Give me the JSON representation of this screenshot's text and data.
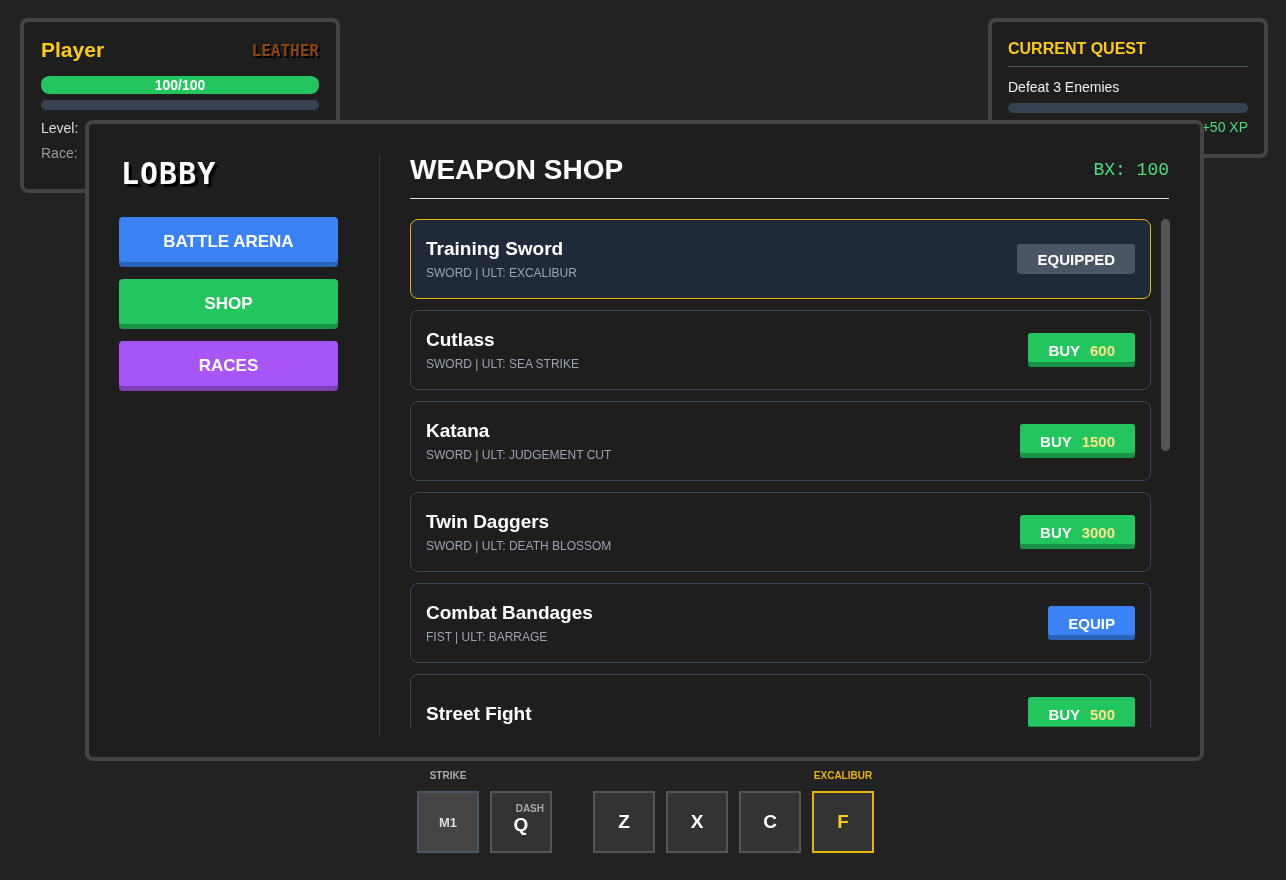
{
  "player": {
    "name": "Player",
    "tier": "LEATHER",
    "hp_text": "100/100",
    "hp": {
      "level": 1
    },
    "xp": {
      "level": 0
    },
    "level_label": "Level:",
    "race_label": "Race:"
  },
  "quest": {
    "title": "CURRENT QUEST",
    "task": "Defeat 3 Enemies",
    "progress": {
      "level": 0
    },
    "reward": "+50 XP"
  },
  "lobby": {
    "title": "LOBBY",
    "nav": [
      {
        "label": "BATTLE ARENA",
        "color": "#3b82f6"
      },
      {
        "label": "SHOP",
        "color": "#22c55e"
      },
      {
        "label": "RACES",
        "color": "#a855f7"
      }
    ]
  },
  "shop": {
    "title": "WEAPON SHOP",
    "balance": "BX: 100",
    "items": [
      {
        "name": "Training Sword",
        "info": "SWORD | ULT: EXCALIBUR",
        "selected": true,
        "action": {
          "kind": "equipped",
          "label": "EQUIPPED"
        }
      },
      {
        "name": "Cutlass",
        "info": "SWORD | ULT: SEA STRIKE",
        "selected": false,
        "action": {
          "kind": "buy",
          "label": "BUY",
          "price": "600"
        }
      },
      {
        "name": "Katana",
        "info": "SWORD | ULT: JUDGEMENT CUT",
        "selected": false,
        "action": {
          "kind": "buy",
          "label": "BUY",
          "price": "1500"
        }
      },
      {
        "name": "Twin Daggers",
        "info": "SWORD | ULT: DEATH BLOSSOM",
        "selected": false,
        "action": {
          "kind": "buy",
          "label": "BUY",
          "price": "3000"
        }
      },
      {
        "name": "Combat Bandages",
        "info": "FIST | ULT: BARRAGE",
        "selected": false,
        "action": {
          "kind": "equip",
          "label": "EQUIP"
        }
      },
      {
        "name": "Street Fight",
        "selected": false,
        "action": {
          "kind": "buy",
          "label": "BUY",
          "price": "500"
        }
      }
    ]
  },
  "abilities": [
    {
      "key": "M1",
      "kind": "basic",
      "top_label": "STRIKE"
    },
    {
      "key": "Q",
      "kind": "skill",
      "inner_label": "DASH"
    },
    {
      "key": "Z",
      "kind": "skill"
    },
    {
      "key": "X",
      "kind": "skill"
    },
    {
      "key": "C",
      "kind": "skill"
    },
    {
      "key": "F",
      "kind": "ult",
      "top_label": "EXCALIBUR"
    }
  ]
}
